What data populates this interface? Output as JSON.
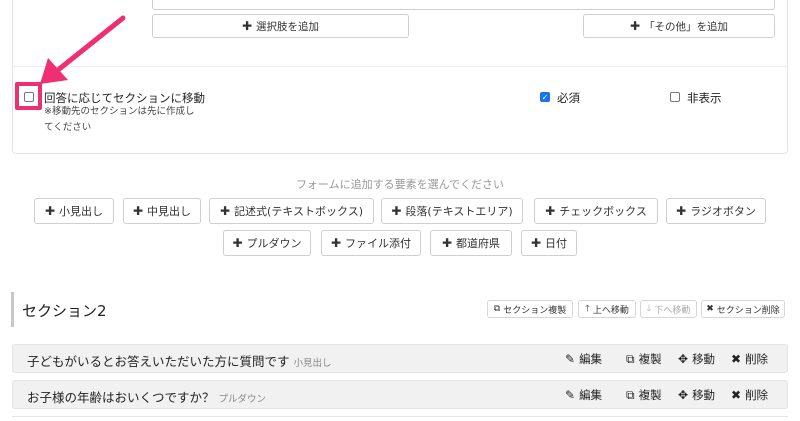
{
  "card": {
    "add_option_label": "選択肢を追加",
    "add_other_label": "「その他」を追加",
    "jump_label": "回答に応じてセクションに移動",
    "jump_note_1": "※移動先のセクションは先に作成し",
    "jump_note_2": "てください",
    "required_label": "必須",
    "required_checked": true,
    "hidden_label": "非表示",
    "hidden_checked": false
  },
  "add_elements": {
    "title": "フォームに追加する要素を選んでください",
    "row1": [
      "小見出し",
      "中見出し",
      "記述式(テキストボックス)",
      "段落(テキストエリア)",
      "チェックボックス",
      "ラジオボタン"
    ],
    "row2": [
      "プルダウン",
      "ファイル添付",
      "都道府県",
      "日付"
    ]
  },
  "section": {
    "title": "セクション2",
    "copy_label": "セクション複製",
    "up_label": "上へ移動",
    "down_label": "下へ移動",
    "delete_label": "セクション削除"
  },
  "questions": [
    {
      "text": "子どもがいるとお答えいただいた方に質問です",
      "type": "小見出し"
    },
    {
      "text": "お子様の年齢はおいくつですか？",
      "type": "プルダウン"
    }
  ],
  "question_actions": {
    "edit": "編集",
    "copy": "複製",
    "move": "移動",
    "delete": "削除"
  },
  "colors": {
    "highlight": "#ee2f72",
    "checkbox_checked": "#1a73e8"
  }
}
